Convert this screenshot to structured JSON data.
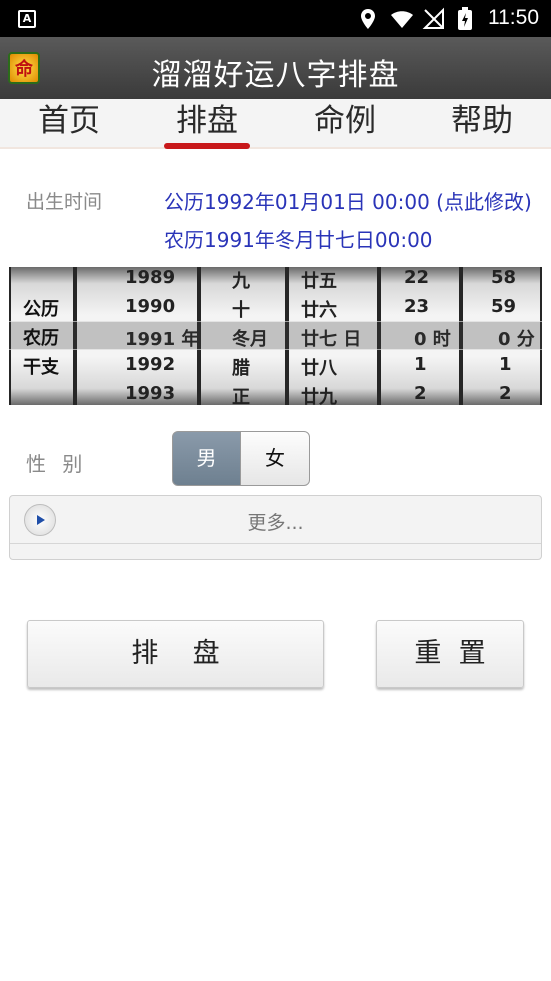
{
  "status_bar": {
    "time": "11:50"
  },
  "app": {
    "title": "溜溜好运八字排盘",
    "logo_char": "命"
  },
  "tabs": [
    {
      "label": "首页",
      "active": false
    },
    {
      "label": "排盘",
      "active": true
    },
    {
      "label": "命例",
      "active": false
    },
    {
      "label": "帮助",
      "active": false
    }
  ],
  "birth": {
    "label": "出生时间",
    "solar": "公历1992年01月01日 00:00 (点此修改)",
    "lunar": "农历1991年冬月廿七日00:00"
  },
  "picker": {
    "row_labels": [
      "公历",
      "农历",
      "干支"
    ],
    "year": [
      "1989",
      "1990",
      "1991 年",
      "1992",
      "1993"
    ],
    "month": [
      "九",
      "十",
      "冬月",
      "腊",
      "正"
    ],
    "day": [
      "廿五",
      "廿六",
      "廿七 日",
      "廿八",
      "廿九"
    ],
    "hour": [
      "22",
      "23",
      "0 时",
      "1",
      "2"
    ],
    "minute": [
      "58",
      "59",
      "0 分",
      "1",
      "2"
    ]
  },
  "gender": {
    "label": "性 别",
    "male": "男",
    "female": "女",
    "selected": "男"
  },
  "more": {
    "label": "更多..."
  },
  "buttons": {
    "chart": "排    盘",
    "reset": "重  置"
  },
  "colors": {
    "accent": "#c8181a",
    "link": "#2a34b8",
    "selected_segment": "#7a8a9a"
  }
}
